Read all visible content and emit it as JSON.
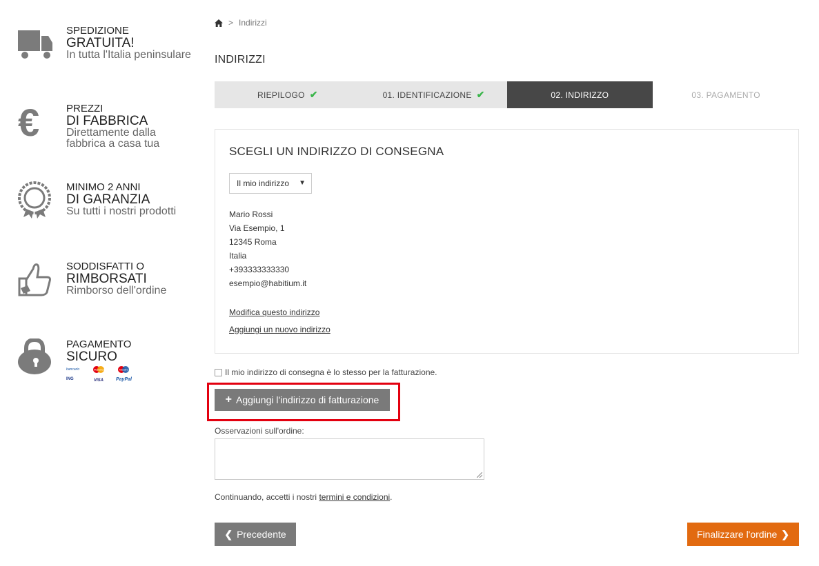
{
  "sidebar": {
    "features": [
      {
        "icon": "truck-icon",
        "small": "SPEDIZIONE",
        "big": "GRATUITA!",
        "sub": [
          "In tutta l'Italia peninsulare"
        ]
      },
      {
        "icon": "euro-icon",
        "small": "PREZZI",
        "big": "DI FABBRICA",
        "sub": [
          "Direttamente dalla",
          "fabbrica a casa tua"
        ]
      },
      {
        "icon": "warranty-badge-icon",
        "small": "MINIMO 2 ANNI",
        "big": "DI GARANZIA",
        "sub": [
          "Su tutti i nostri prodotti"
        ]
      },
      {
        "icon": "thumbs-up-icon",
        "small": "SODDISFATTI O",
        "big": "RIMBORSATI",
        "sub": [
          "Rimborso dell'ordine"
        ]
      },
      {
        "icon": "lock-icon",
        "small": "PAGAMENTO",
        "big": "SICURO",
        "sub": []
      }
    ],
    "payment_logos": [
      "bancario",
      "MasterCard",
      "Maestro",
      "ING",
      "VISA",
      "PayPal"
    ]
  },
  "breadcrumb": {
    "home_icon": "home-icon",
    "separator": ">",
    "current": "Indirizzi"
  },
  "page_title": "INDIRIZZI",
  "steps": [
    {
      "label": "RIEPILOGO",
      "state": "done"
    },
    {
      "label": "01. IDENTIFICAZIONE",
      "state": "done"
    },
    {
      "label": "02. INDIRIZZO",
      "state": "active"
    },
    {
      "label": "03. PAGAMENTO",
      "state": "future"
    }
  ],
  "address_box": {
    "title": "SCEGLI UN INDIRIZZO DI CONSEGNA",
    "select_value": "Il mio indirizzo",
    "lines": [
      "Mario Rossi",
      "Via Esempio, 1",
      "12345 Roma",
      "Italia",
      "+393333333330",
      "esempio@habitium.it"
    ],
    "edit_link": "Modifica questo indirizzo",
    "add_link": "Aggiungi un nuovo indirizzo"
  },
  "same_billing_label": "Il mio indirizzo di consegna è lo stesso per la fatturazione.",
  "add_billing_button": "Aggiungi l'indirizzo di fatturazione",
  "observations_label": "Osservazioni sull'ordine:",
  "terms": {
    "prefix": "Continuando, accetti i nostri",
    "link": "termini e condizioni",
    "suffix": "."
  },
  "prev_button": "Precedente",
  "finalize_button": "Finalizzare l'ordine",
  "colors": {
    "accent": "#e26a10",
    "check": "#3ab54a",
    "highlight": "#e3000f",
    "active_step": "#474747"
  }
}
